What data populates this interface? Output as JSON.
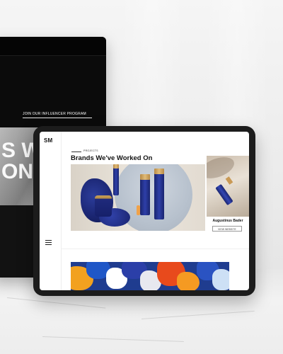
{
  "monitor": {
    "heading": "JOIN OUR INFLUENCER PROGRAM",
    "bigtext": "S WI\nON."
  },
  "tablet": {
    "logo": "SM",
    "projects_label": "PROJECTS",
    "page_title": "Brands We've Worked On",
    "featured_brand": {
      "name": "Augustinus Bader",
      "button_label": "VIEW WEBSITE"
    }
  },
  "colors": {
    "brand_blue": "#1b2673",
    "gold": "#c8a15a",
    "monitor_bg": "#0b0b0b",
    "tablet_frame": "#1c1c1c"
  },
  "icons": [
    "menu-icon"
  ]
}
